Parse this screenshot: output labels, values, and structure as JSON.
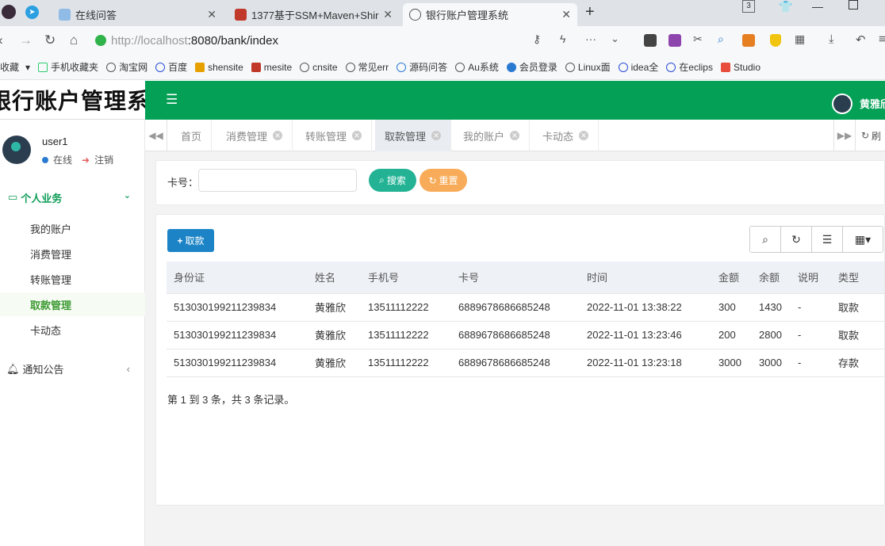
{
  "browser": {
    "tabs": [
      {
        "title": "在线问答"
      },
      {
        "title": "1377基于SSM+Maven+Shir"
      },
      {
        "title": "银行账户管理系统"
      }
    ],
    "tab_count": "3",
    "url_host": "http://localhost",
    "url_path": ":8080/bank/index",
    "bookmarks": [
      "收藏",
      "手机收藏夹",
      "淘宝网",
      "百度",
      "shensite",
      "mesite",
      "cnsite",
      "常见err",
      "源码问答",
      "Au系统",
      "会员登录",
      "Linux面",
      "idea全",
      "在eclips",
      "Studio"
    ]
  },
  "app": {
    "logo": "银行账户管理系统",
    "header_user": "黄雅欣",
    "sidebar": {
      "username": "user1",
      "status": "在线",
      "logout": "注销",
      "group": "个人业务",
      "items": [
        "我的账户",
        "消费管理",
        "转账管理",
        "取款管理",
        "卡动态"
      ],
      "active_index": 3,
      "notice": "通知公告"
    },
    "page_tabs": [
      "首页",
      "消费管理",
      "转账管理",
      "取款管理",
      "我的账户",
      "卡动态"
    ],
    "active_page_tab": "取款管理",
    "refresh_label": "刷"
  },
  "search": {
    "label": "卡号：",
    "value": "",
    "search_btn": "搜索",
    "reset_btn": "重置"
  },
  "table": {
    "add_btn": "取款",
    "columns": [
      "身份证",
      "姓名",
      "手机号",
      "卡号",
      "时间",
      "金额",
      "余额",
      "说明",
      "类型"
    ],
    "rows": [
      [
        "513030199211239834",
        "黄雅欣",
        "13511112222",
        "6889678686685248",
        "2022-11-01 13:38:22",
        "300",
        "1430",
        "-",
        "取款"
      ],
      [
        "513030199211239834",
        "黄雅欣",
        "13511112222",
        "6889678686685248",
        "2022-11-01 13:23:46",
        "200",
        "2800",
        "-",
        "取款"
      ],
      [
        "513030199211239834",
        "黄雅欣",
        "13511112222",
        "6889678686685248",
        "2022-11-01 13:23:18",
        "3000",
        "3000",
        "-",
        "存款"
      ]
    ],
    "pagination": "第 1 到 3 条，共 3 条记录。"
  },
  "colors": {
    "header_green": "#03a055",
    "search_btn": "#23b394",
    "reset_btn": "#f8ac59",
    "add_btn": "#1c84c6"
  }
}
